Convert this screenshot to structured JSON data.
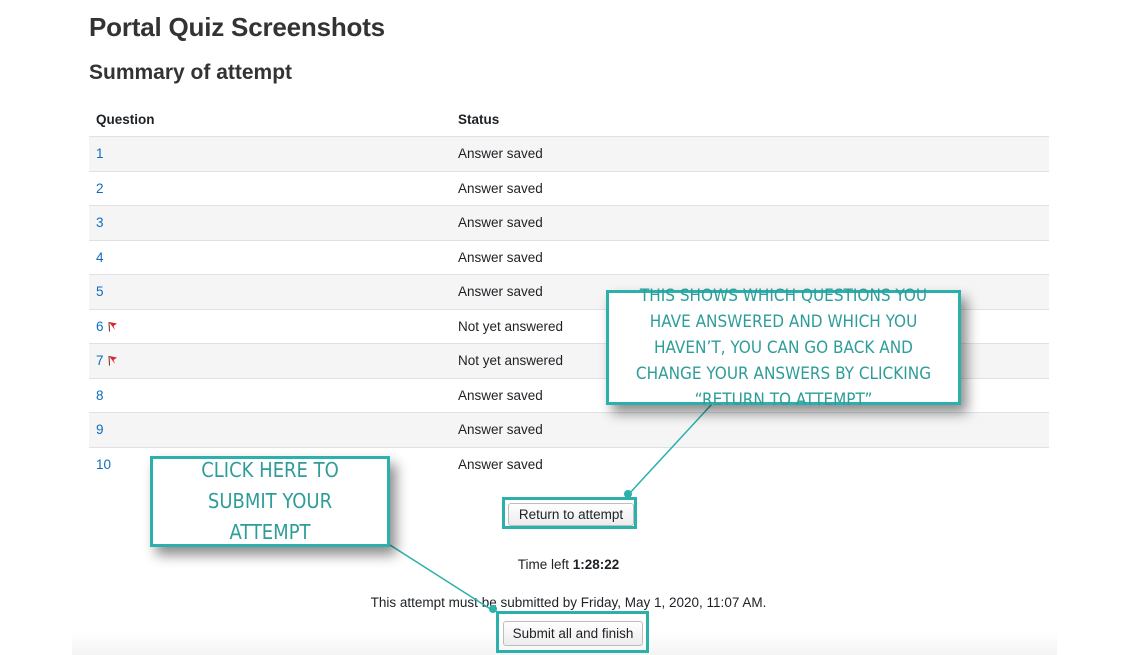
{
  "page_title": "Portal Quiz Screenshots",
  "summary_heading": "Summary of attempt",
  "table": {
    "headers": {
      "question": "Question",
      "status": "Status"
    },
    "rows": [
      {
        "question": "1",
        "status": "Answer saved",
        "flagged": false
      },
      {
        "question": "2",
        "status": "Answer saved",
        "flagged": false
      },
      {
        "question": "3",
        "status": "Answer saved",
        "flagged": false
      },
      {
        "question": "4",
        "status": "Answer saved",
        "flagged": false
      },
      {
        "question": "5",
        "status": "Answer saved",
        "flagged": false
      },
      {
        "question": "6",
        "status": "Not yet answered",
        "flagged": true
      },
      {
        "question": "7",
        "status": "Not yet answered",
        "flagged": true
      },
      {
        "question": "8",
        "status": "Answer saved",
        "flagged": false
      },
      {
        "question": "9",
        "status": "Answer saved",
        "flagged": false
      },
      {
        "question": "10",
        "status": "Answer saved",
        "flagged": false
      }
    ]
  },
  "return_button_label": "Return to attempt",
  "time_left": {
    "label": "Time left",
    "value": "1:28:22"
  },
  "deadline_text": "This attempt must be submitted by Friday, May 1, 2020, 11:07 AM.",
  "submit_button_label": "Submit all and finish",
  "callouts": {
    "top": "This shows which questions you have answered and which you haven’t, you can go back and change your answers by clicking “Return to attempt”",
    "left": "Click here to submit your  attempt"
  },
  "colors": {
    "link": "#0f6cbf",
    "callout_border": "#2bb0ab",
    "callout_text": "#2e9d9a",
    "flag": "#d9262b",
    "row_stripe": "#f5f5f5"
  },
  "icons": {
    "flag": "flag-icon"
  }
}
